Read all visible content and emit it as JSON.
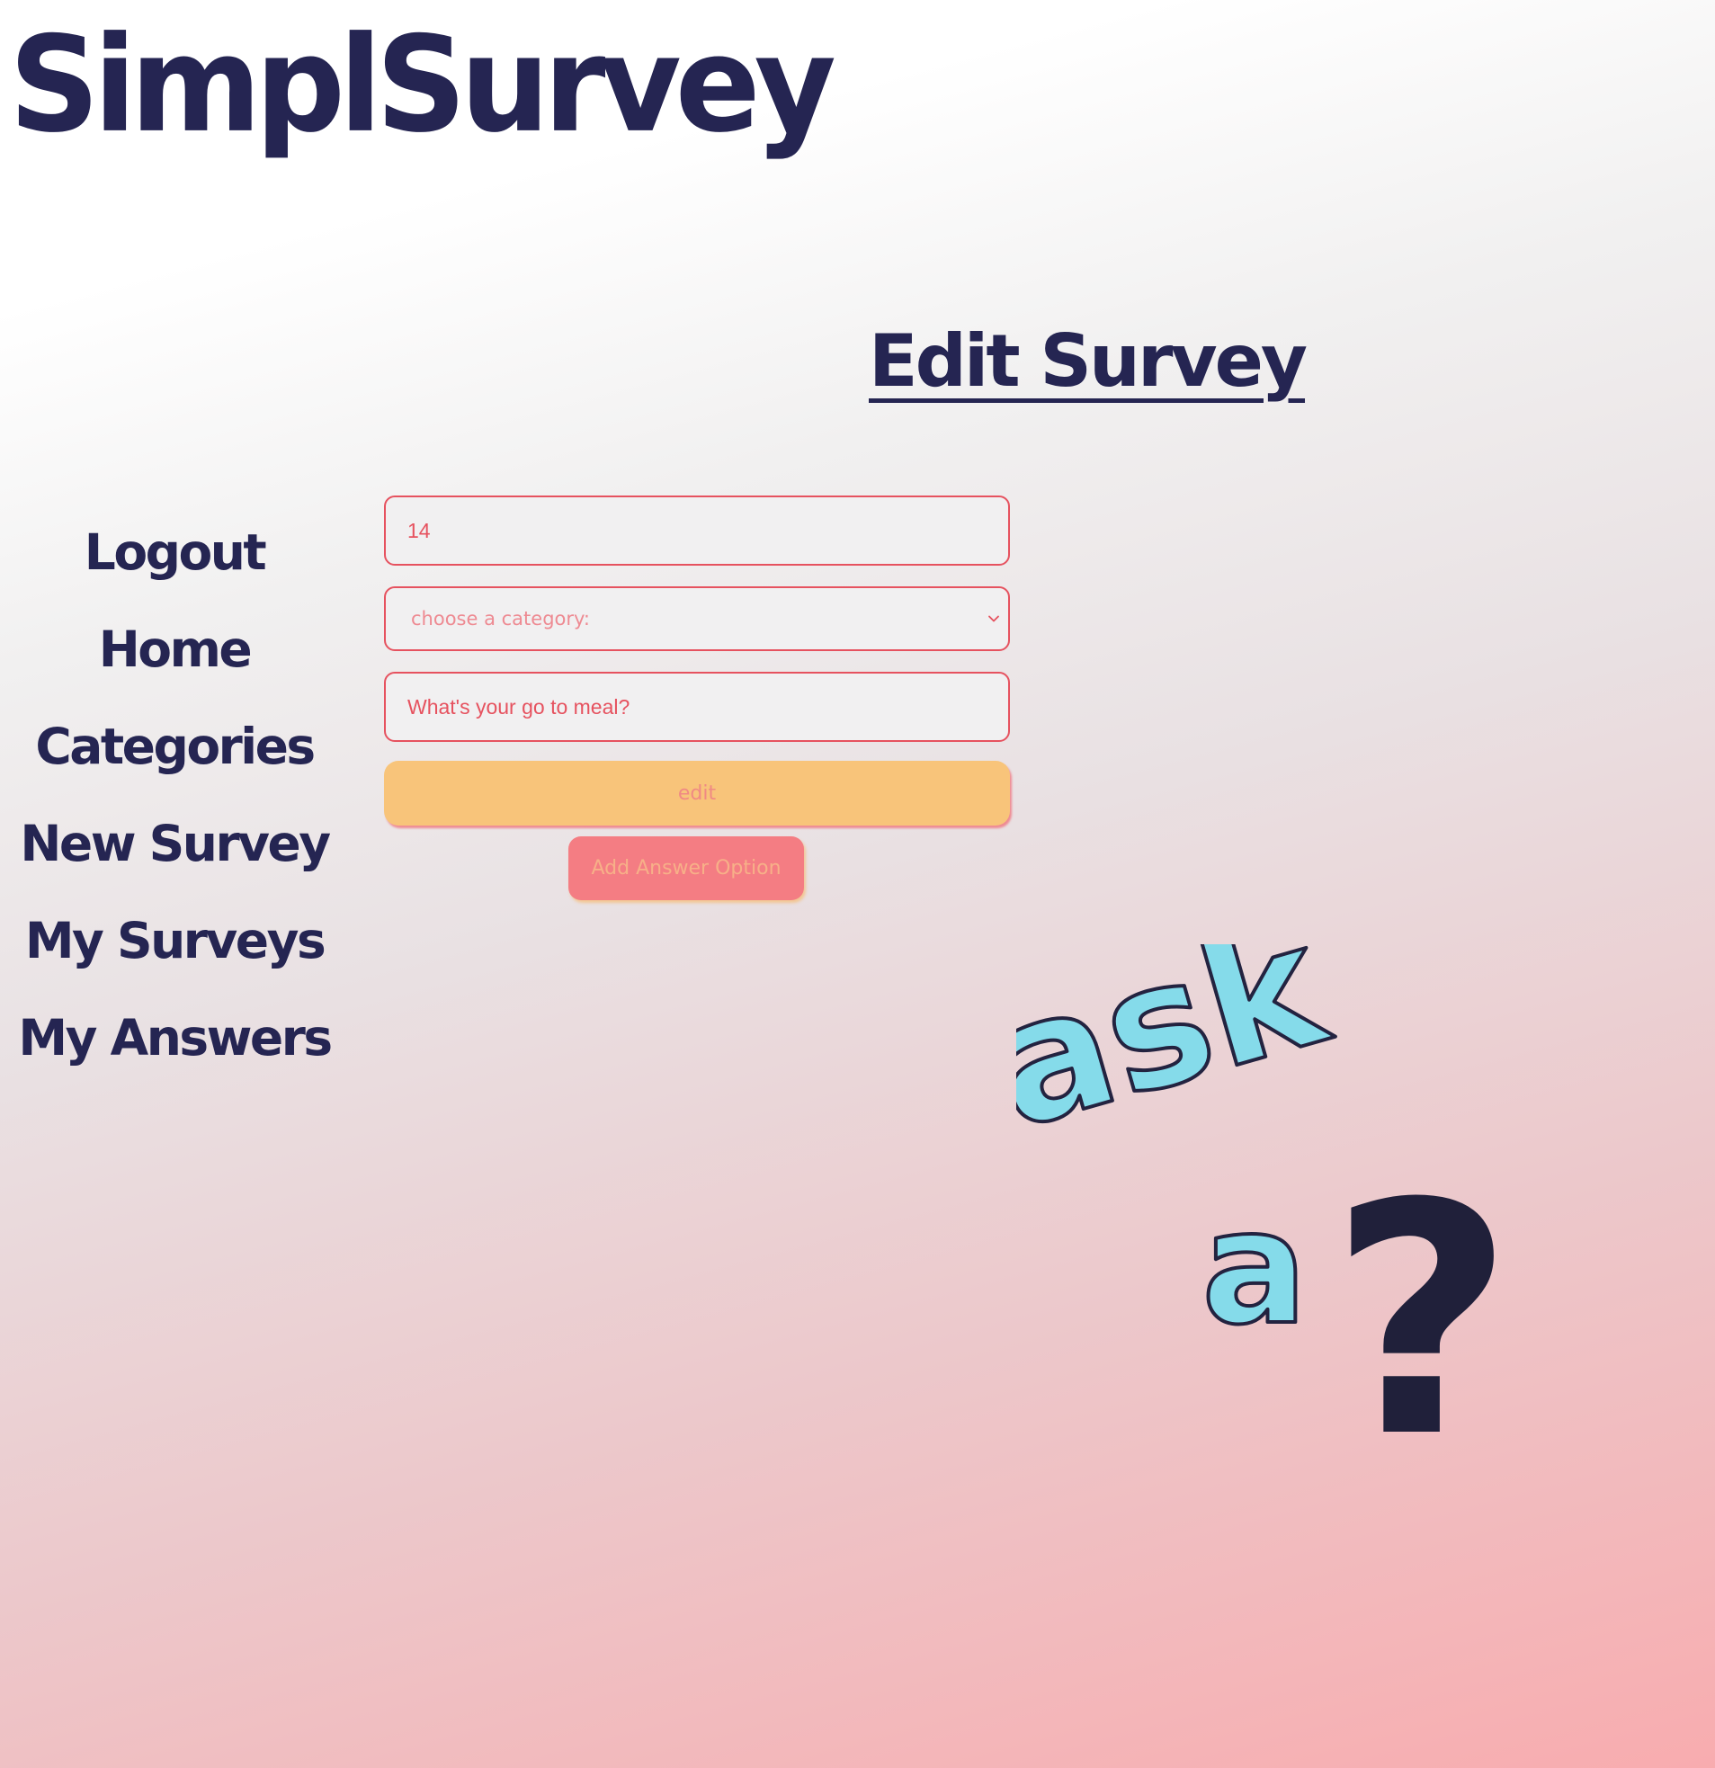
{
  "header": {
    "app_title": "SimplSurvey"
  },
  "page": {
    "heading": "Edit Survey"
  },
  "sidebar": {
    "items": [
      {
        "label": "Logout"
      },
      {
        "label": "Home"
      },
      {
        "label": "Categories"
      },
      {
        "label": "New Survey"
      },
      {
        "label": "My Surveys"
      },
      {
        "label": "My Answers"
      }
    ]
  },
  "form": {
    "id_value": "14",
    "category_placeholder": "choose a category:",
    "question_value": "What's your go to meal?",
    "edit_label": "edit",
    "add_answer_label": "Add Answer Option"
  },
  "graphic": {
    "word_ask": "ask",
    "word_a": "a",
    "question_mark": "?"
  },
  "icons": {
    "category_select": "chevron-down-icon"
  },
  "colors": {
    "brand_navy": "#252552",
    "accent_red": "#e6525f",
    "edit_button_bg": "#f8c47a",
    "add_button_bg": "#f47d83",
    "graphic_cyan": "#85dbea"
  }
}
